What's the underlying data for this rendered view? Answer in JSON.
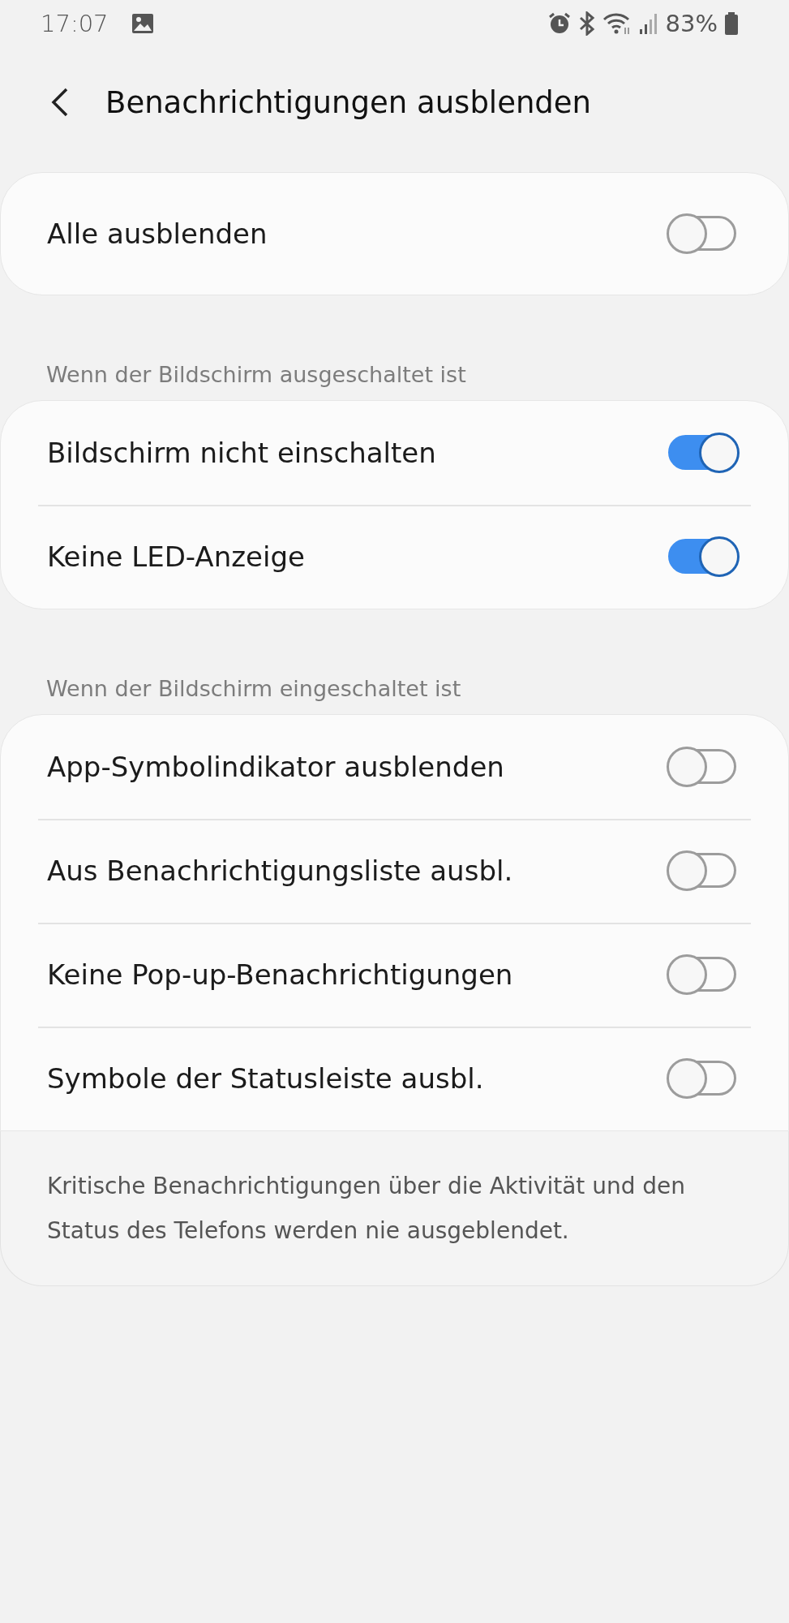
{
  "status_bar": {
    "time": "17:07",
    "battery": "83%"
  },
  "header": {
    "title": "Benachrichtigungen ausblenden"
  },
  "master": {
    "label": "Alle ausblenden",
    "on": false
  },
  "sections": [
    {
      "title": "Wenn der Bildschirm ausgeschaltet ist",
      "items": [
        {
          "label": "Bildschirm nicht einschalten",
          "on": true
        },
        {
          "label": "Keine LED-Anzeige",
          "on": true
        }
      ]
    },
    {
      "title": "Wenn der Bildschirm eingeschaltet ist",
      "items": [
        {
          "label": "App-Symbolindikator ausblenden",
          "on": false
        },
        {
          "label": "Aus Benachrichtigungsliste ausbl.",
          "on": false
        },
        {
          "label": "Keine Pop-up-Benachrichtigungen",
          "on": false
        },
        {
          "label": "Symbole der Statusleiste ausbl.",
          "on": false
        }
      ]
    }
  ],
  "footnote": "Kritische Benachrichtigungen über die Aktivität und den Status des Telefons werden nie ausgeblendet."
}
